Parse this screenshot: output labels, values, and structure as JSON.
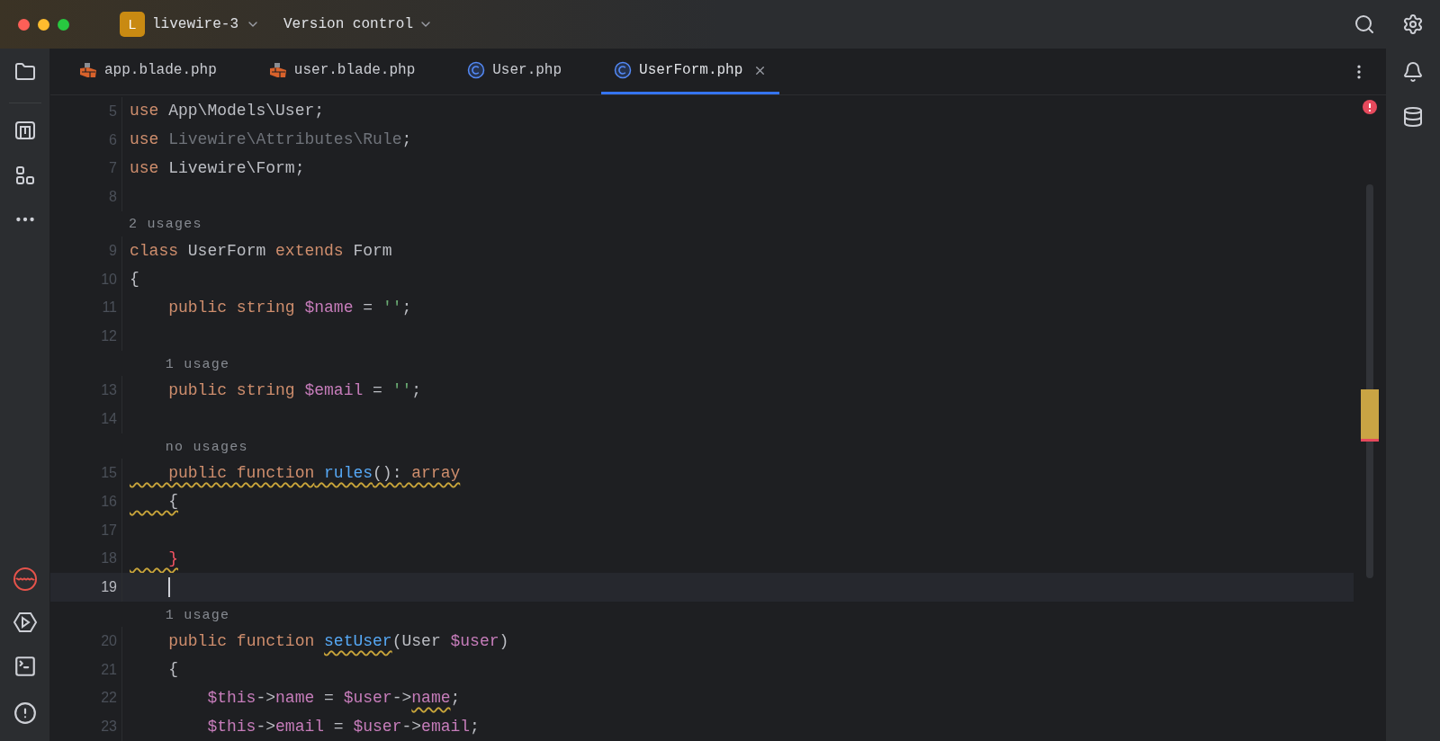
{
  "window": {
    "project_badge": "L",
    "project": "livewire-3",
    "vcs": "Version control"
  },
  "tabs": [
    {
      "label": "app.blade.php",
      "kind": "blade",
      "selected": false
    },
    {
      "label": "user.blade.php",
      "kind": "blade",
      "selected": false
    },
    {
      "label": "User.php",
      "kind": "class",
      "selected": false
    },
    {
      "label": "UserForm.php",
      "kind": "class",
      "selected": true
    }
  ],
  "lines": [
    {
      "kind": "code",
      "number": "5",
      "current": false,
      "tokens": [
        {
          "text": "use",
          "kind": "kw"
        },
        {
          "text": " App\\Models\\User;",
          "kind": "plain"
        }
      ]
    },
    {
      "kind": "code",
      "number": "6",
      "current": false,
      "tokens": [
        {
          "text": "use",
          "kind": "kw"
        },
        {
          "text": " Livewire\\Attributes\\Rule",
          "kind": "dim"
        },
        {
          "text": ";",
          "kind": "plain"
        }
      ]
    },
    {
      "kind": "code",
      "number": "7",
      "current": false,
      "tokens": [
        {
          "text": "use",
          "kind": "kw"
        },
        {
          "text": " Livewire\\Form;",
          "kind": "plain"
        }
      ]
    },
    {
      "kind": "code",
      "number": "8",
      "current": false
    },
    {
      "kind": "hint",
      "text": "2 usages"
    },
    {
      "kind": "code",
      "number": "9",
      "current": false,
      "tokens": [
        {
          "text": "class",
          "kind": "kw"
        },
        {
          "text": " UserForm",
          "kind": "plain"
        },
        {
          "text": " extends",
          "kind": "kw"
        },
        {
          "text": " Form",
          "kind": "plain"
        }
      ]
    },
    {
      "kind": "code",
      "number": "10",
      "current": false,
      "tokens": [
        {
          "text": "{",
          "kind": "plain"
        }
      ]
    },
    {
      "kind": "code",
      "number": "11",
      "current": false,
      "tokens": [
        {
          "text": "    public",
          "kind": "kw"
        },
        {
          "text": " string",
          "kind": "kw"
        },
        {
          "text": " $name",
          "kind": "var"
        },
        {
          "text": " = ",
          "kind": "plain"
        },
        {
          "text": "''",
          "kind": "str"
        },
        {
          "text": ";",
          "kind": "plain"
        }
      ]
    },
    {
      "kind": "code",
      "number": "12",
      "current": false
    },
    {
      "kind": "hint",
      "text": "    1 usage"
    },
    {
      "kind": "code",
      "number": "13",
      "current": false,
      "tokens": [
        {
          "text": "    public",
          "kind": "kw"
        },
        {
          "text": " string",
          "kind": "kw"
        },
        {
          "text": " $email",
          "kind": "var"
        },
        {
          "text": " = ",
          "kind": "plain"
        },
        {
          "text": "''",
          "kind": "str"
        },
        {
          "text": ";",
          "kind": "plain"
        }
      ]
    },
    {
      "kind": "code",
      "number": "14",
      "current": false
    },
    {
      "kind": "hint",
      "text": "    no usages"
    },
    {
      "kind": "code",
      "number": "15",
      "current": false,
      "tokens": [
        {
          "text": "    public function",
          "kind": "kw",
          "warning": true
        },
        {
          "text": " rules",
          "kind": "fn",
          "warning": true
        },
        {
          "text": "():",
          "kind": "plain",
          "warning": true
        },
        {
          "text": " array",
          "kind": "kw",
          "warning": true
        }
      ]
    },
    {
      "kind": "code",
      "number": "16",
      "current": false,
      "tokens": [
        {
          "text": "    {",
          "kind": "plain",
          "warning": true
        }
      ]
    },
    {
      "kind": "code",
      "number": "17",
      "current": false
    },
    {
      "kind": "code",
      "number": "18",
      "current": false,
      "tokens": [
        {
          "text": "    }",
          "kind": "error",
          "warning": true
        }
      ]
    },
    {
      "kind": "code",
      "number": "19",
      "current": true
    },
    {
      "kind": "hint",
      "text": "    1 usage"
    },
    {
      "kind": "code",
      "number": "20",
      "current": false,
      "tokens": [
        {
          "text": "    public",
          "kind": "kw"
        },
        {
          "text": " function ",
          "kind": "kw"
        },
        {
          "text": "setUser",
          "kind": "fn",
          "warning": true
        },
        {
          "text": "(User",
          "kind": "plain"
        },
        {
          "text": " $user",
          "kind": "var"
        },
        {
          "text": ")",
          "kind": "plain"
        }
      ]
    },
    {
      "kind": "code",
      "number": "21",
      "current": false,
      "tokens": [
        {
          "text": "    {",
          "kind": "plain"
        }
      ]
    },
    {
      "kind": "code",
      "number": "22",
      "current": false,
      "tokens": [
        {
          "text": "        $this",
          "kind": "var"
        },
        {
          "text": "->",
          "kind": "plain"
        },
        {
          "text": "name",
          "kind": "var"
        },
        {
          "text": " = ",
          "kind": "plain"
        },
        {
          "text": "$user",
          "kind": "var"
        },
        {
          "text": "->",
          "kind": "plain"
        },
        {
          "text": "name",
          "kind": "var",
          "warning": true
        },
        {
          "text": ";",
          "kind": "plain"
        }
      ]
    },
    {
      "kind": "code",
      "number": "23",
      "current": false,
      "tokens": [
        {
          "text": "        $this",
          "kind": "var"
        },
        {
          "text": "->",
          "kind": "plain"
        },
        {
          "text": "email",
          "kind": "var"
        },
        {
          "text": " = ",
          "kind": "plain"
        },
        {
          "text": "$user",
          "kind": "var"
        },
        {
          "text": "->",
          "kind": "plain"
        },
        {
          "text": "email",
          "kind": "var"
        },
        {
          "text": ";",
          "kind": "plain"
        }
      ]
    }
  ]
}
